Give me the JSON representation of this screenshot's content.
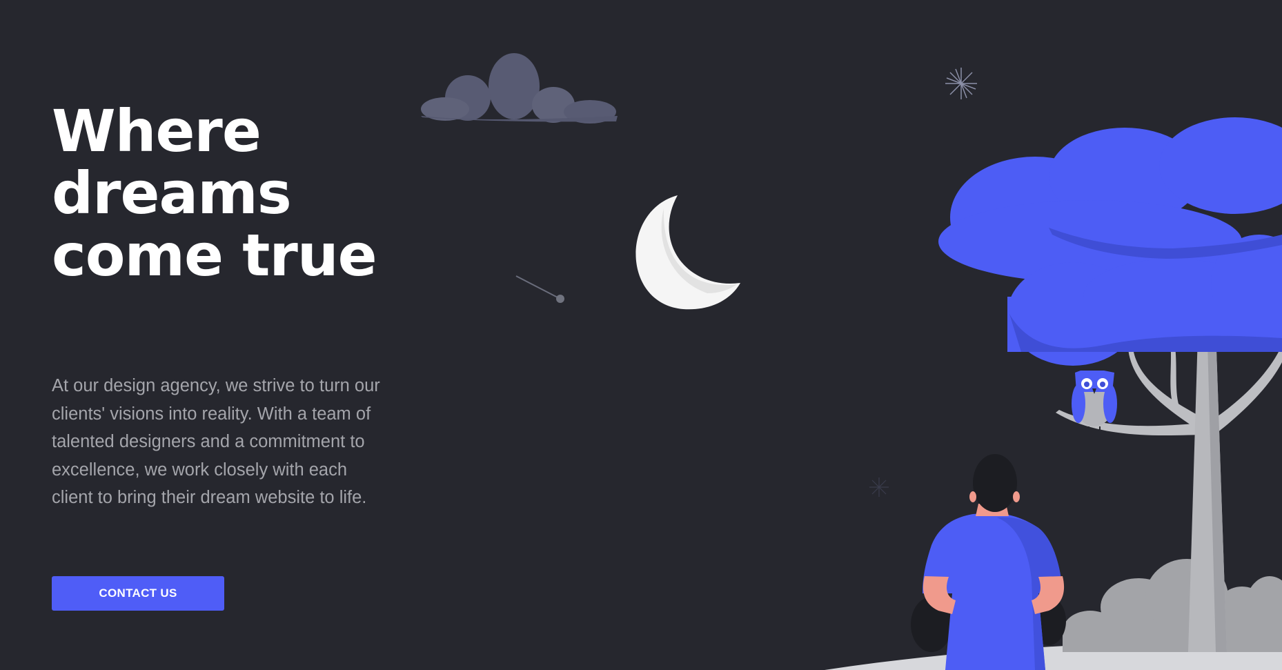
{
  "hero": {
    "headline_lines": [
      "Where",
      "dreams",
      "come true"
    ],
    "description": "At our design agency, we strive to turn our clients' visions into reality. With a team of talented designers and a commitment to excellence, we work closely with each client to bring their dream website to life.",
    "cta_label": "CONTACT US"
  },
  "colors": {
    "background": "#26272e",
    "accent": "#4f5df7",
    "headline": "#ffffff",
    "body_text": "#a4a5ab"
  },
  "illustration": {
    "elements": [
      "cloud",
      "crescent-moon",
      "shooting-star",
      "sparkle",
      "tree",
      "owl",
      "person",
      "bush",
      "ground"
    ]
  }
}
